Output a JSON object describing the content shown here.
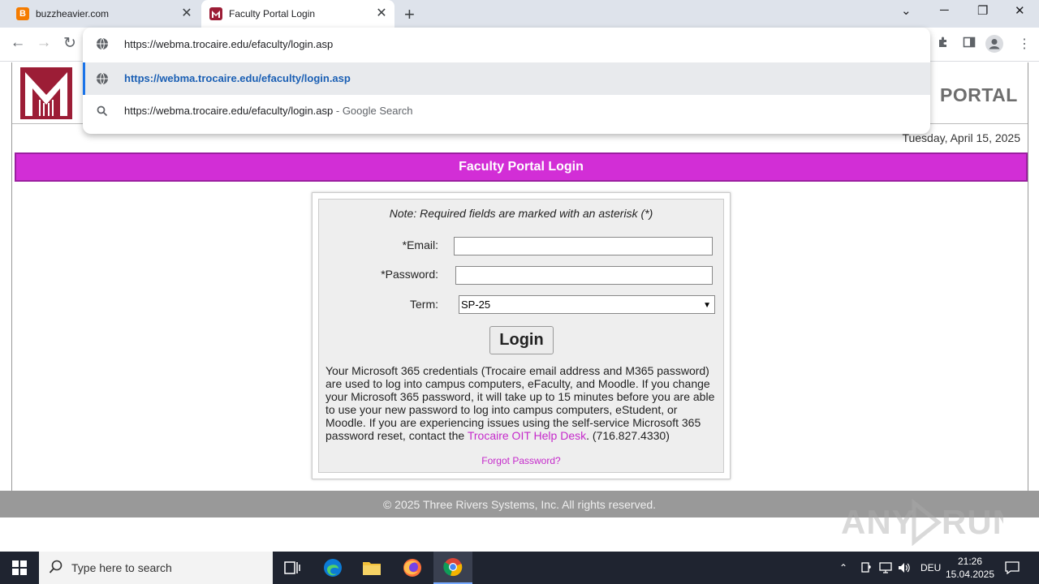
{
  "browser": {
    "tabs": [
      {
        "title": "buzzheavier.com",
        "favicon_letter": "B",
        "favicon_color": "#f57c00",
        "active": false
      },
      {
        "title": "Faculty Portal Login",
        "active": true
      }
    ],
    "omnibox": {
      "input_text": "https://webma.trocaire.edu/efaculty/login.asp",
      "suggestions": [
        {
          "text": "https://webma.trocaire.edu/efaculty/login.asp",
          "icon": "globe-icon"
        },
        {
          "text": "https://webma.trocaire.edu/efaculty/login.asp",
          "suffix": " - Google Search",
          "icon": "search-icon"
        }
      ]
    }
  },
  "page": {
    "header_portal_word": "PORTAL",
    "date": "Tuesday, April 15, 2025",
    "banner_title": "Faculty Portal Login",
    "note": "Note: Required fields are marked with an asterisk (*)",
    "form": {
      "email_label": "*Email:",
      "password_label": "*Password:",
      "term_label": "Term:",
      "term_value": "SP-25",
      "login_label": "Login"
    },
    "info_text_1": "Your Microsoft 365 credentials (Trocaire email address and M365 password) are used to log into campus computers, eFaculty, and Moodle. If you change your Microsoft 365 password, it will take up to 15 minutes before you are able to use your new password to log into campus computers, eStudent, or Moodle. If you are experiencing issues using the self-service Microsoft 365 password reset, contact the ",
    "info_link": "Trocaire OIT Help Desk",
    "info_text_2": ". (716.827.4330)",
    "forgot_password": "Forgot Password?",
    "footer": "© 2025 Three Rivers Systems, Inc. All rights reserved."
  },
  "watermark": "ANY RUN",
  "colors": {
    "banner": "#d22ed6",
    "logo": "#9c1d36",
    "link": "#c52acb"
  },
  "taskbar": {
    "search_placeholder": "Type here to search",
    "language": "DEU",
    "time": "21:26",
    "date": "15.04.2025"
  }
}
